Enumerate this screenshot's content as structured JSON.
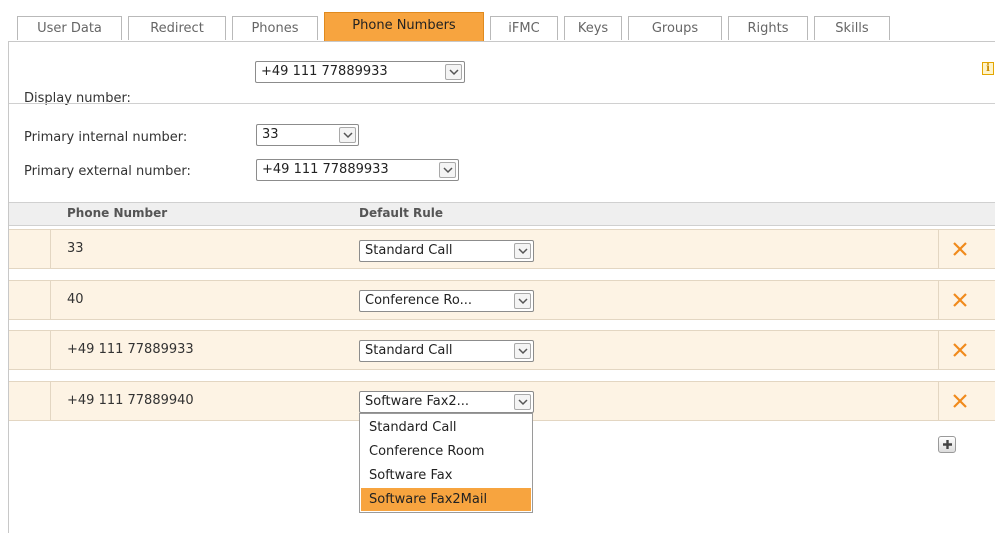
{
  "tabs": [
    {
      "label": "User Data",
      "active": false
    },
    {
      "label": "Redirect",
      "active": false
    },
    {
      "label": "Phones",
      "active": false
    },
    {
      "label": "Phone Numbers",
      "active": true
    },
    {
      "label": "iFMC",
      "active": false
    },
    {
      "label": "Keys",
      "active": false
    },
    {
      "label": "Groups",
      "active": false
    },
    {
      "label": "Rights",
      "active": false
    },
    {
      "label": "Skills",
      "active": false
    }
  ],
  "display": {
    "label": "Display number:",
    "value": "+49 111 77889933"
  },
  "primary_internal": {
    "label": "Primary internal number:",
    "value": "33"
  },
  "primary_external": {
    "label": "Primary external number:",
    "value": "+49 111 77889933"
  },
  "table": {
    "headers": {
      "phone_number": "Phone Number",
      "default_rule": "Default Rule"
    },
    "rows": [
      {
        "number": "33",
        "rule": "Standard Call"
      },
      {
        "number": "40",
        "rule": "Conference Ro..."
      },
      {
        "number": "+49 111 77889933",
        "rule": "Standard Call"
      },
      {
        "number": "+49 111 77889940",
        "rule": "Software Fax2..."
      }
    ]
  },
  "dropdown": {
    "options": [
      "Standard Call",
      "Conference Room",
      "Software Fax",
      "Software Fax2Mail"
    ],
    "selected": "Software Fax2Mail"
  },
  "icons": {
    "info": "info-icon",
    "delete": "close-icon",
    "add": "plus-icon",
    "dropdown": "chevron-down-icon"
  },
  "colors": {
    "accent": "#f7a43f",
    "row_bg": "#fdf3e4",
    "delete": "#f08a1c"
  }
}
